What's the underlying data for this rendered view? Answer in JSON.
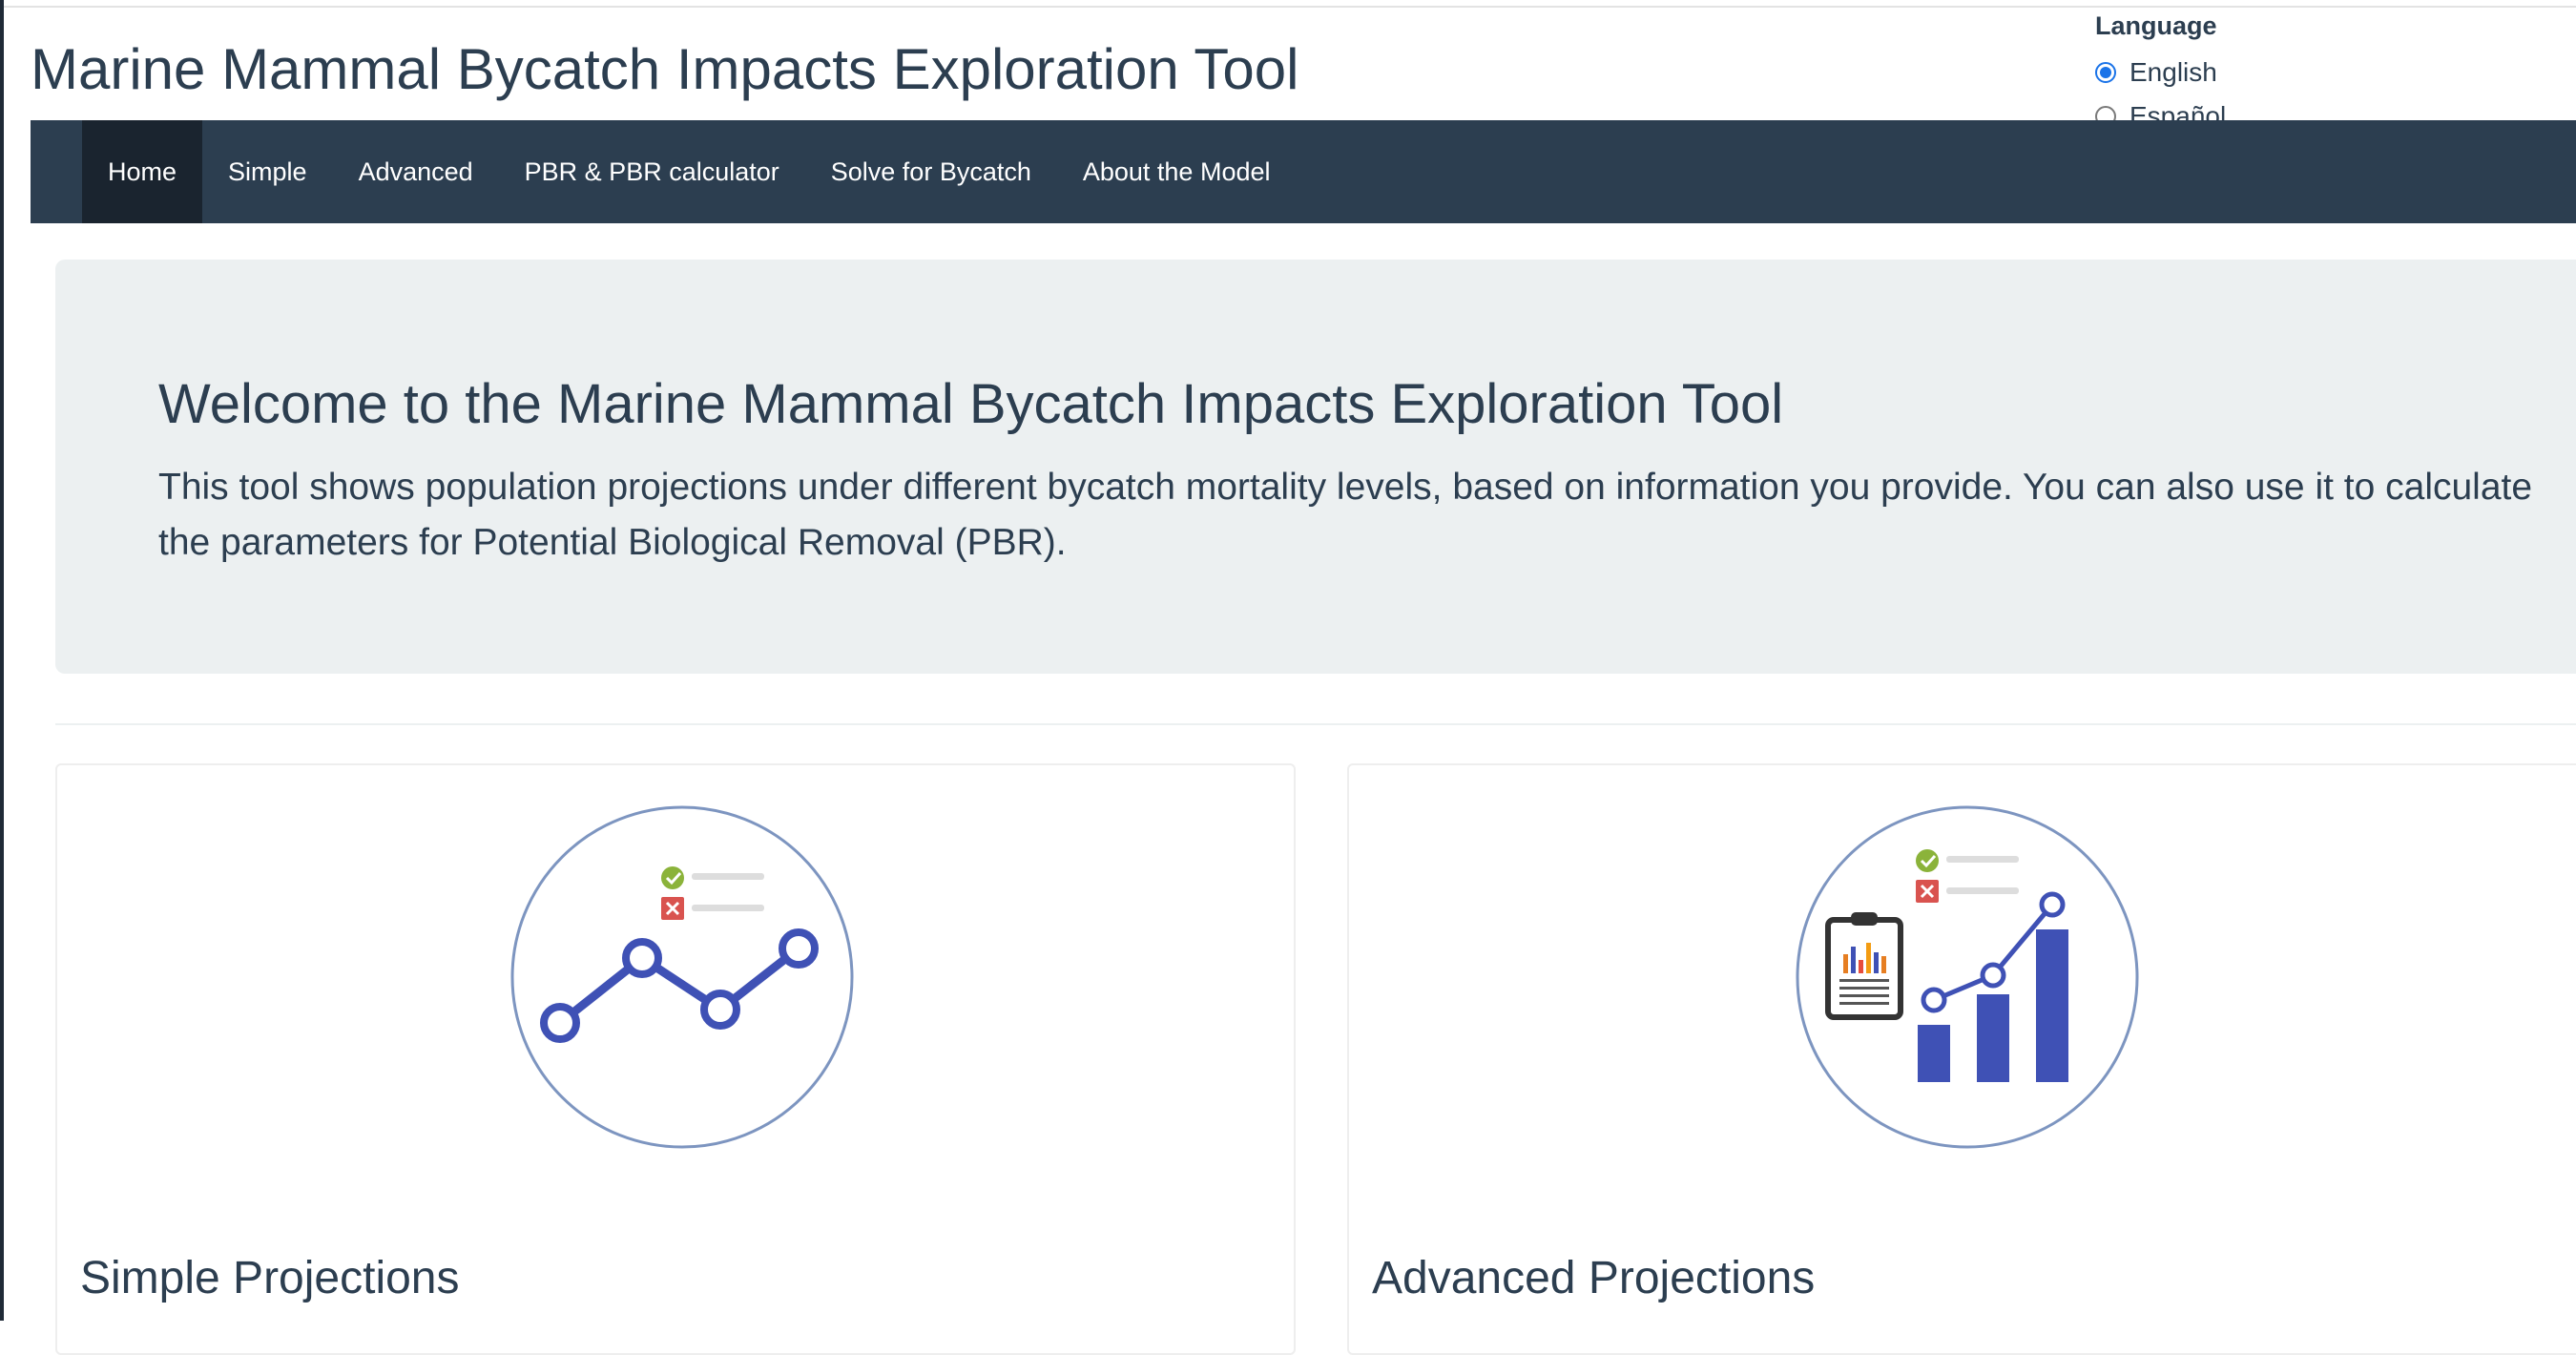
{
  "app": {
    "title": "Marine Mammal Bycatch Impacts Exploration Tool"
  },
  "language": {
    "label": "Language",
    "options": [
      {
        "label": "English",
        "selected": true
      },
      {
        "label": "Español",
        "selected": false
      }
    ]
  },
  "nav": {
    "items": [
      {
        "label": "Home",
        "active": true
      },
      {
        "label": "Simple",
        "active": false
      },
      {
        "label": "Advanced",
        "active": false
      },
      {
        "label": "PBR & PBR calculator",
        "active": false
      },
      {
        "label": "Solve for Bycatch",
        "active": false
      },
      {
        "label": "About the Model",
        "active": false
      }
    ]
  },
  "hero": {
    "title": "Welcome to the Marine Mammal Bycatch Impacts Exploration Tool",
    "text": "This tool shows population projections under different bycatch mortality levels, based on information you provide. You can also use it to calculate the parameters for Potential Biological Removal (PBR)."
  },
  "cards": [
    {
      "title": "Simple Projections",
      "icon": "line-chart-icon"
    },
    {
      "title": "Advanced Projections",
      "icon": "bar-chart-icon"
    }
  ],
  "colors": {
    "navbar": "#2c3e50",
    "navbar_active": "#1a242f",
    "jumbotron": "#ecf0f1",
    "icon_blue": "#3f51b5",
    "circle_outline": "#7d95c0",
    "check_green": "#8bb33a",
    "cross_red": "#d9534f"
  }
}
